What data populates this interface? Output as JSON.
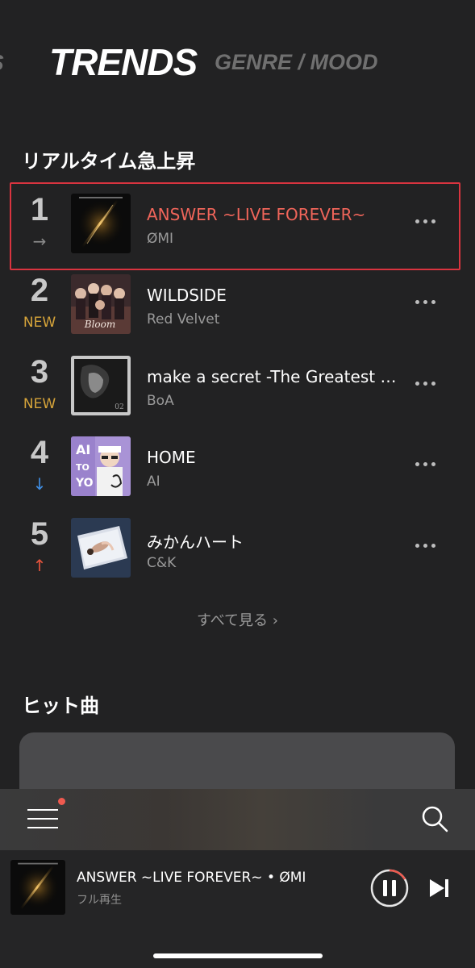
{
  "tabs": {
    "prev": "S",
    "active": "TRENDS",
    "next": "GENRE / MOOD"
  },
  "realtime": {
    "title": "リアルタイム急上昇",
    "see_all": "すべて見る ›",
    "items": [
      {
        "rank": "1",
        "trend": "→",
        "trend_type": "same",
        "title": "ANSWER ~LIVE FOREVER~",
        "artist": "ØMI",
        "playing": true
      },
      {
        "rank": "2",
        "trend": "NEW",
        "trend_type": "new",
        "title": "WILDSIDE",
        "artist": "Red Velvet",
        "playing": false
      },
      {
        "rank": "3",
        "trend": "NEW",
        "trend_type": "new",
        "title": "make a secret -The Greatest Hits-",
        "artist": "BoA",
        "playing": false
      },
      {
        "rank": "4",
        "trend": "↓",
        "trend_type": "down",
        "title": "HOME",
        "artist": "AI",
        "playing": false
      },
      {
        "rank": "5",
        "trend": "↑",
        "trend_type": "up",
        "title": "みかんハート",
        "artist": "C&K",
        "playing": false
      }
    ]
  },
  "hits": {
    "title": "ヒット曲"
  },
  "player": {
    "now_playing": "ANSWER ~LIVE FOREVER~ • ØMI",
    "subtitle": "フル再生"
  },
  "colors": {
    "background": "#222223",
    "accent_playing": "#f0655a",
    "highlight_border": "#d9343f",
    "trend_new": "#d6a43a",
    "trend_down": "#3f8ce0",
    "trend_up": "#e5533c",
    "notification_dot": "#ef5a4f"
  },
  "icons": {
    "menu": "hamburger-icon",
    "search": "search-icon",
    "pause": "pause-icon",
    "next": "skip-next-icon",
    "more": "more-horizontal-icon"
  }
}
